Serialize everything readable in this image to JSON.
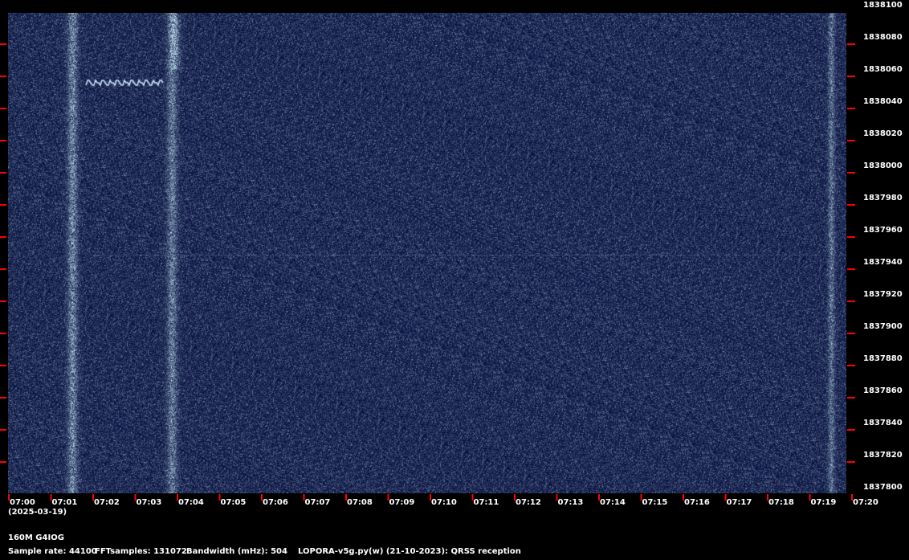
{
  "plot": {
    "background": "#07103e",
    "signal_color": "#cfe6ff",
    "tick_color": "#ff0000"
  },
  "y_axis": {
    "labels": [
      "1838100",
      "1838080",
      "1838060",
      "1838040",
      "1838020",
      "1838000",
      "1837980",
      "1837960",
      "1837940",
      "1837920",
      "1837900",
      "1837880",
      "1837860",
      "1837840",
      "1837820",
      "1837800"
    ]
  },
  "x_axis": {
    "labels": [
      "07:00",
      "07:01",
      "07:02",
      "07:03",
      "07:04",
      "07:05",
      "07:06",
      "07:07",
      "07:08",
      "07:09",
      "07:10",
      "07:11",
      "07:12",
      "07:13",
      "07:14",
      "07:15",
      "07:16",
      "07:17",
      "07:18",
      "07:19",
      "07:20"
    ],
    "date": "(2025-03-19)"
  },
  "info": {
    "station": "160M G4IOG",
    "sample_rate": "Sample rate: 44100",
    "fft_samples": "FFTsamples: 131072",
    "bandwidth": "Bandwidth (mHz): 504",
    "software": "LOPORA-v5g.py(w) (21-10-2023): QRSS reception"
  }
}
